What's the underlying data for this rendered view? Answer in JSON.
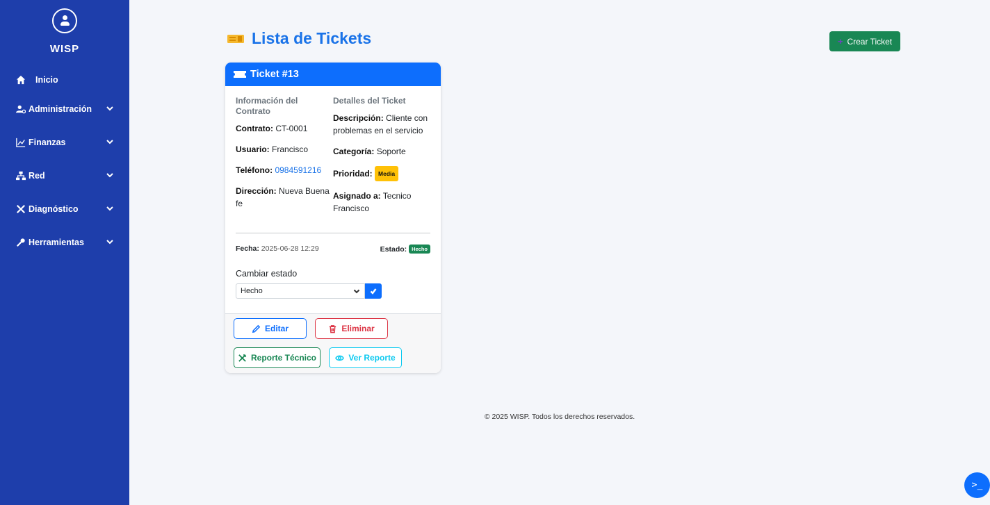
{
  "sidebar": {
    "brand": "WISP",
    "items": [
      {
        "label": "Inicio",
        "icon": "home-icon",
        "has_submenu": false
      },
      {
        "label": "Administración",
        "icon": "user-cog-icon",
        "has_submenu": true
      },
      {
        "label": "Finanzas",
        "icon": "chart-line-icon",
        "has_submenu": true
      },
      {
        "label": "Red",
        "icon": "network-icon",
        "has_submenu": true
      },
      {
        "label": "Diagnóstico",
        "icon": "tools-icon",
        "has_submenu": true
      },
      {
        "label": "Herramientas",
        "icon": "wrench-icon",
        "has_submenu": true
      }
    ]
  },
  "header": {
    "title": "Lista de Tickets",
    "create_label": "Crear Ticket"
  },
  "ticket": {
    "title": "Ticket #13",
    "contract_section": "Información del Contrato",
    "details_section": "Detalles del Ticket",
    "contrato_label": "Contrato:",
    "contrato": "CT-0001",
    "usuario_label": "Usuario:",
    "usuario": "Francisco",
    "telefono_label": "Teléfono:",
    "telefono": "0984591216",
    "direccion_label": "Dirección:",
    "direccion": "Nueva Buena fe",
    "descripcion_label": "Descripción:",
    "descripcion": "Cliente con problemas en el servicio",
    "categoria_label": "Categoría:",
    "categoria": "Soporte",
    "prioridad_label": "Prioridad:",
    "prioridad": "Media",
    "asignado_label": "Asignado a:",
    "asignado": "Tecnico Francisco",
    "fecha_label": "Fecha:",
    "fecha": "2025-06-28 12:29",
    "estado_label": "Estado:",
    "estado": "Hecho",
    "change_label": "Cambiar estado",
    "select_value": "Hecho",
    "buttons": {
      "edit": "Editar",
      "delete": "Eliminar",
      "report": "Reporte Técnico",
      "view": "Ver Reporte"
    }
  },
  "footer": "© 2025 WISP. Todos los derechos reservados.",
  "terminal_label": ">_",
  "colors": {
    "sidebar": "#1e3eab",
    "primary": "#0d6efd",
    "success": "#198754",
    "danger": "#dc3545",
    "info": "#0dcaf0",
    "warning": "#ffc107"
  }
}
